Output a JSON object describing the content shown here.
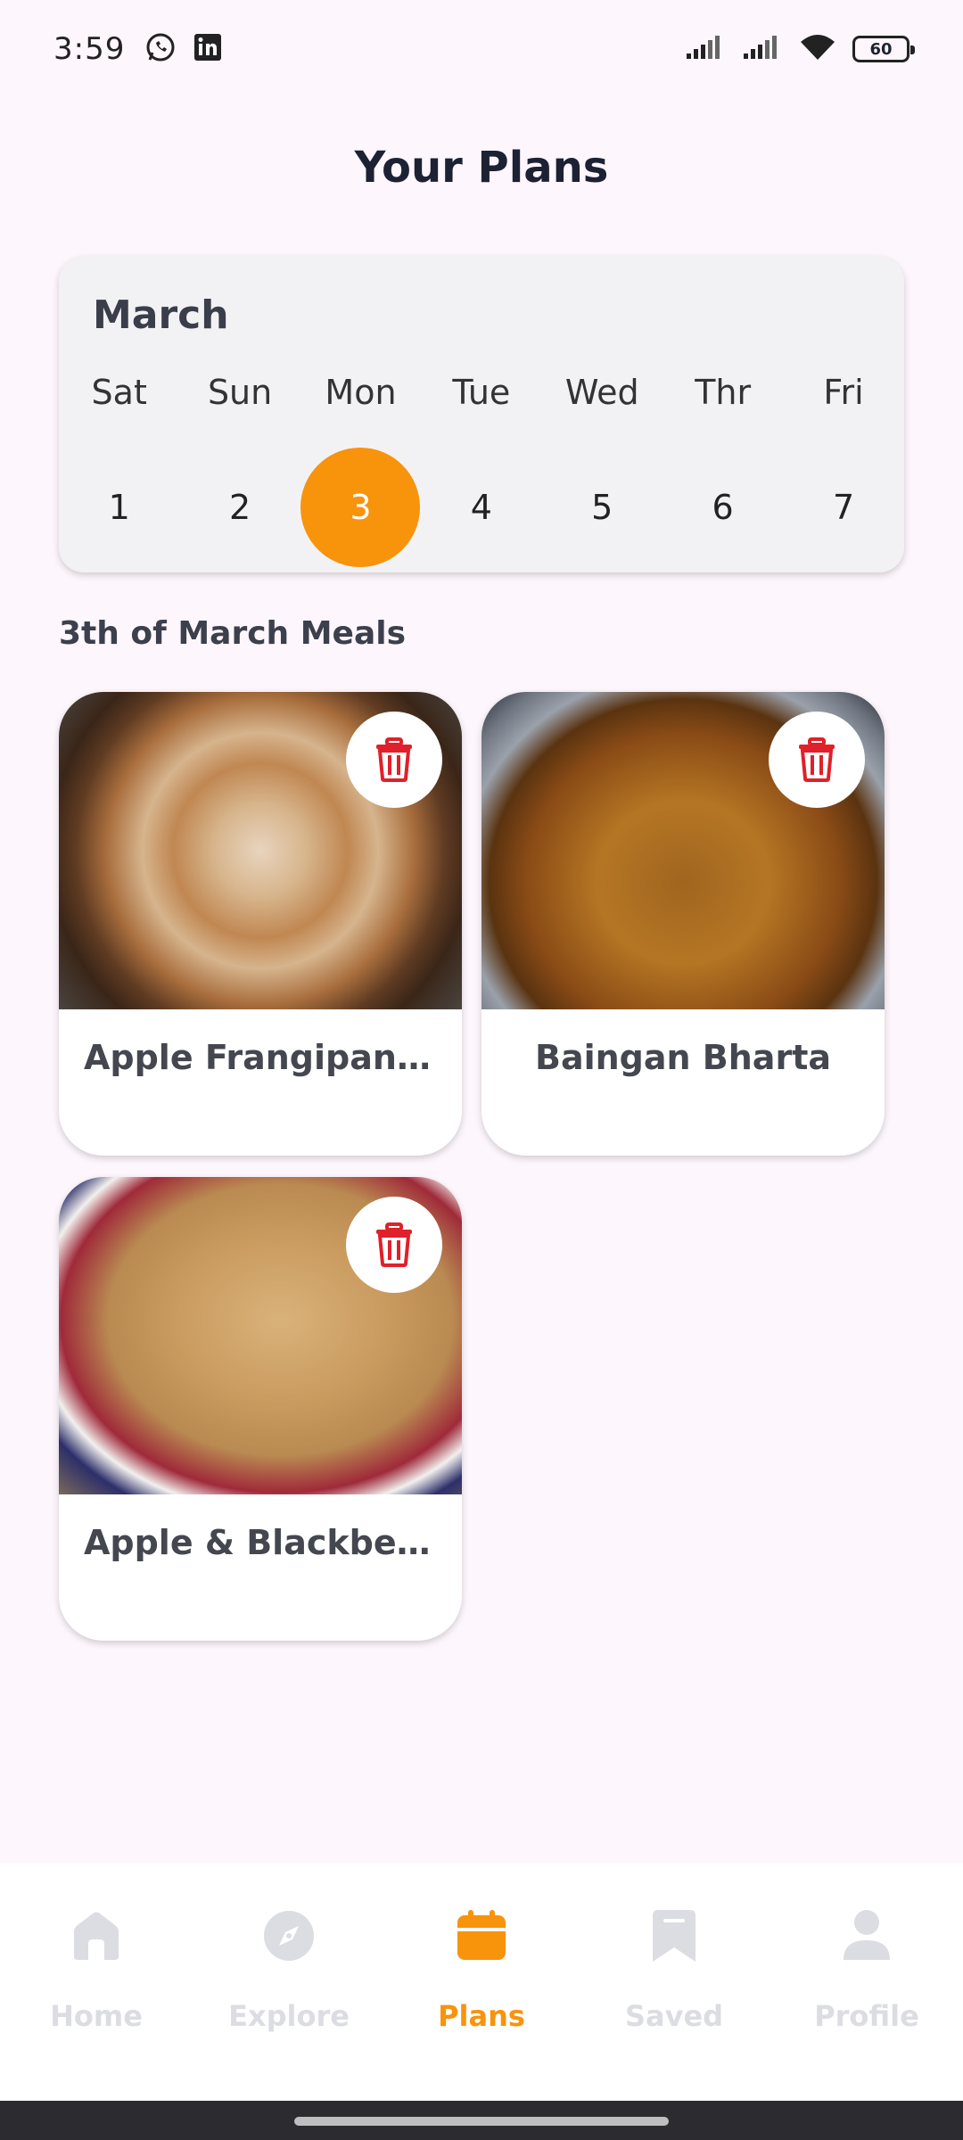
{
  "status_bar": {
    "time": "3:59",
    "battery": "60"
  },
  "header": {
    "title": "Your Plans"
  },
  "calendar": {
    "month": "March",
    "days": [
      {
        "name": "Sat",
        "num": "1"
      },
      {
        "name": "Sun",
        "num": "2"
      },
      {
        "name": "Mon",
        "num": "3",
        "selected": true
      },
      {
        "name": "Tue",
        "num": "4"
      },
      {
        "name": "Wed",
        "num": "5"
      },
      {
        "name": "Thr",
        "num": "6"
      },
      {
        "name": "Fri",
        "num": "7"
      }
    ],
    "selected_color": "#f8930c"
  },
  "meals_section": {
    "heading": "3th of March Meals",
    "meals": [
      {
        "title": "Apple Frangipan T..."
      },
      {
        "title": "Baingan Bharta"
      },
      {
        "title": "Apple & Blackberry..."
      }
    ]
  },
  "bottom_nav": {
    "items": [
      {
        "label": "Home",
        "icon": "home-icon"
      },
      {
        "label": "Explore",
        "icon": "compass-icon"
      },
      {
        "label": "Plans",
        "icon": "calendar-icon",
        "active": true
      },
      {
        "label": "Saved",
        "icon": "bookmark-icon"
      },
      {
        "label": "Profile",
        "icon": "person-icon"
      }
    ],
    "active_color": "#f8930c",
    "inactive_color": "#dcdde2"
  },
  "colors": {
    "accent": "#f8930c",
    "delete": "#e0202a",
    "background": "#fdf6fc"
  }
}
